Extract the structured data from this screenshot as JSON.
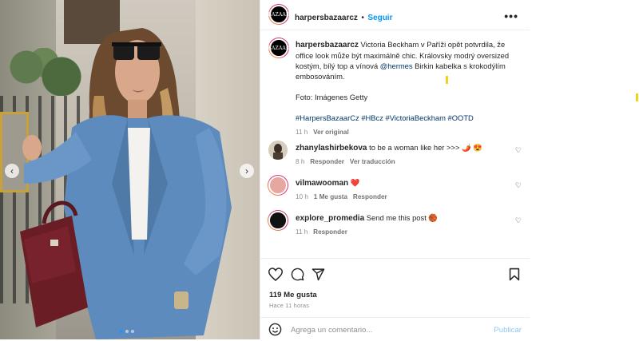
{
  "post": {
    "author": "harpersbazaarcz",
    "follow_label": "Seguir",
    "separator": "•",
    "avatar_text": "BAZAAR",
    "more_label": "•••",
    "caption_text": "Victoria Beckham v Paříži opět potvrdila, že office look může být maximálně chic. Královsky modrý oversized kostým, bílý top a vínová",
    "caption_mention": "@hermes",
    "caption_text_2": "Birkin kabelka s krokodýlím embosováním.",
    "caption_credit": "Foto: Imágenes Getty",
    "hashtags": "#HarpersBazaarCz #HBcz #VictoriaBeckham #OOTD",
    "caption_time": "11 h",
    "see_translation": "Ver original"
  },
  "comments": [
    {
      "user": "zhanylashirbekova",
      "text": "to be a woman like her >>> 🌶️ 😍",
      "time": "8 h",
      "actions": [
        "Responder",
        "Ver traducción"
      ]
    },
    {
      "user": "vilmawooman",
      "text": "❤️",
      "time": "10 h",
      "actions": [
        "1 Me gusta",
        "Responder"
      ]
    },
    {
      "user": "explore_promedia",
      "text": "Send me this post 🏀",
      "time": "11 h",
      "actions": [
        "Responder"
      ]
    }
  ],
  "footer": {
    "likes": "119 Me gusta",
    "ago": "Hace 11 horas",
    "comment_placeholder": "Agrega un comentario...",
    "publish_label": "Publicar"
  },
  "icons": {
    "like": "heart-icon",
    "comment": "comment-icon",
    "share": "send-icon",
    "save": "bookmark-icon",
    "emoji": "emoji-icon"
  },
  "colors": {
    "accent": "#0095f6",
    "link": "#00376b",
    "muted": "#8e8e8e",
    "suit": "#5d8bbd"
  },
  "carousel": {
    "prev": "‹",
    "next": "›",
    "slide_count": 3,
    "active_index": 1
  }
}
